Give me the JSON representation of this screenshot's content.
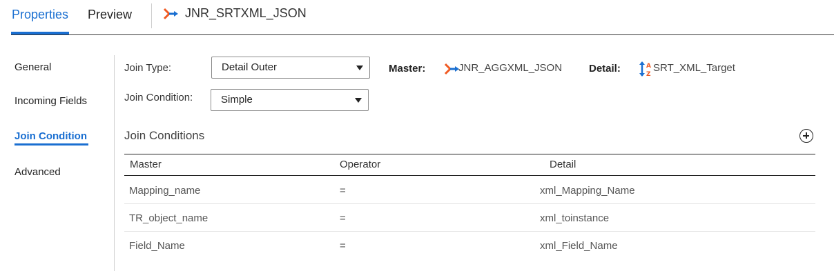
{
  "header": {
    "tabs": [
      {
        "label": "Properties",
        "active": true
      },
      {
        "label": "Preview",
        "active": false
      }
    ],
    "transformation_name": "JNR_SRTXML_JSON",
    "transformation_icon": "joiner-icon"
  },
  "sidebar": {
    "items": [
      {
        "label": "General",
        "active": false
      },
      {
        "label": "Incoming Fields",
        "active": false
      },
      {
        "label": "Join Condition",
        "active": true
      },
      {
        "label": "Advanced",
        "active": false
      }
    ]
  },
  "form": {
    "join_type_label": "Join Type:",
    "join_type_value": "Detail Outer",
    "join_condition_label": "Join Condition:",
    "join_condition_value": "Simple",
    "master_label": "Master:",
    "master_value": "JNR_AGGXML_JSON",
    "master_icon": "joiner-icon",
    "detail_label": "Detail:",
    "detail_value": "SRT_XML_Target",
    "detail_icon": "sorter-icon"
  },
  "conditions": {
    "title": "Join Conditions",
    "add_icon": "add-circle-icon",
    "columns": [
      "Master",
      "Operator",
      "Detail"
    ],
    "rows": [
      {
        "master": "Mapping_name",
        "operator": "=",
        "detail": "xml_Mapping_Name"
      },
      {
        "master": "TR_object_name",
        "operator": "=",
        "detail": "xml_toinstance"
      },
      {
        "master": "Field_Name",
        "operator": "=",
        "detail": "xml_Field_Name"
      }
    ]
  },
  "colors": {
    "accent": "#1a6fd1",
    "joiner_orange": "#f05a22",
    "joiner_blue": "#1a6fd1"
  }
}
